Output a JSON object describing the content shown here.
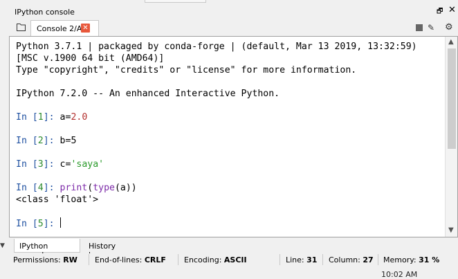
{
  "pane": {
    "title": "IPython console",
    "undock_glyph": "🗗",
    "close_glyph": "✕"
  },
  "tabs": [
    {
      "label": "Console 2/A",
      "close_glyph": "✕"
    }
  ],
  "toolbar": {
    "stop_icon": "stop-square",
    "eraser_icon": "eraser",
    "gear_icon": "gear",
    "eraser_glyph": "✎",
    "gear_glyph": "⚙"
  },
  "console": {
    "banner_1": "Python 3.7.1 | packaged by conda-forge | (default, Mar 13 2019, 13:32:59)",
    "banner_2": "[MSC v.1900 64 bit (AMD64)]",
    "banner_3": "Type \"copyright\", \"credits\" or \"license\" for more information.",
    "banner_4": "IPython 7.2.0 -- An enhanced Interactive Python.",
    "prompt_prefix": "In [",
    "prompt_suffix": "]: ",
    "cells": [
      {
        "n": "1",
        "pre": "a=",
        "val": "2.0"
      },
      {
        "n": "2",
        "pre": "b=",
        "val": "5"
      },
      {
        "n": "3",
        "pre": "c=",
        "val": "'saya'"
      },
      {
        "n": "4",
        "pre": "print",
        "mid": "(",
        "fn": "type",
        "post": "(a))",
        "output": "<class 'float'>"
      },
      {
        "n": "5"
      }
    ]
  },
  "bottom_tabs": [
    {
      "label": "IPython console"
    },
    {
      "label": "History log"
    }
  ],
  "status": {
    "permissions_label": "Permissions:",
    "permissions": "RW",
    "eol_label": "End-of-lines:",
    "eol": "CRLF",
    "encoding_label": "Encoding:",
    "encoding": "ASCII",
    "line_label": "Line:",
    "line": "31",
    "column_label": "Column:",
    "column": "27",
    "memory_label": "Memory:",
    "memory": "31 %"
  },
  "clock": "10:02 AM"
}
